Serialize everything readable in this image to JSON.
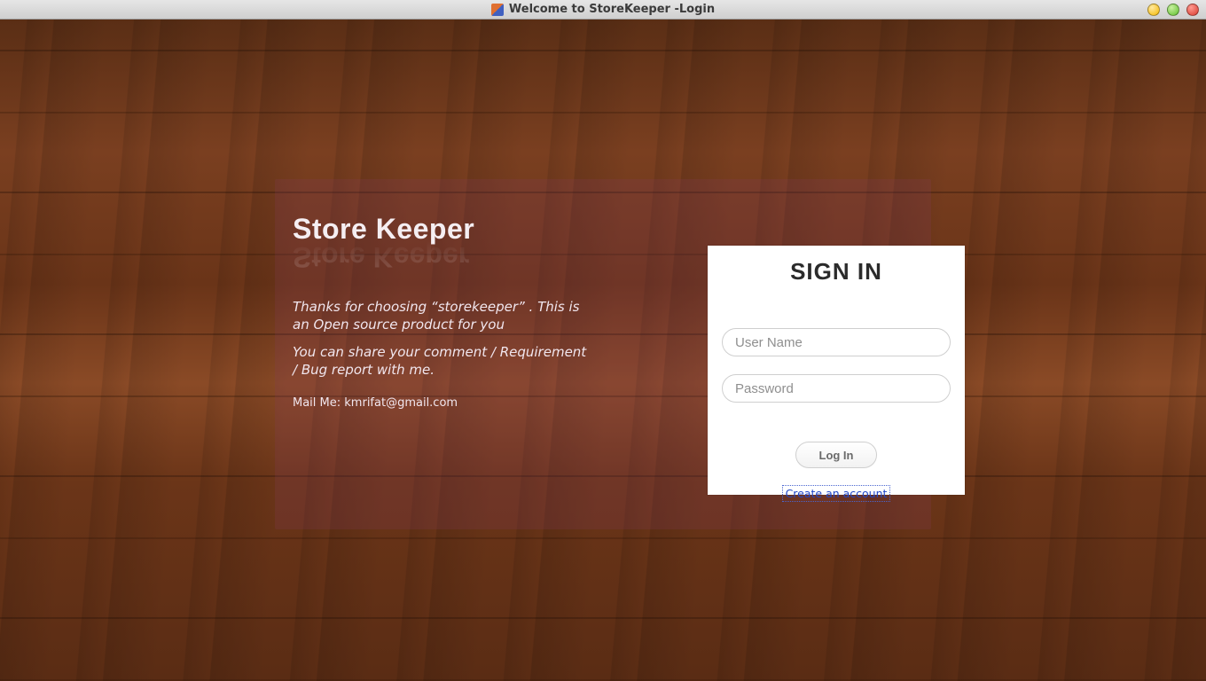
{
  "window": {
    "title": "Welcome to StoreKeeper -Login"
  },
  "brand": "Store Keeper",
  "intro": {
    "p1": "Thanks for choosing “storekeeper” . This is an Open source product for you",
    "p2": "You can share your comment / Requirement / Bug report with me."
  },
  "mail": {
    "label": "Mail Me:",
    "address": "kmrifat@gmail.com"
  },
  "signin": {
    "heading": "SIGN IN",
    "username_placeholder": "User Name",
    "password_placeholder": "Password",
    "login_label": "Log In",
    "create_label": "Create an account"
  }
}
